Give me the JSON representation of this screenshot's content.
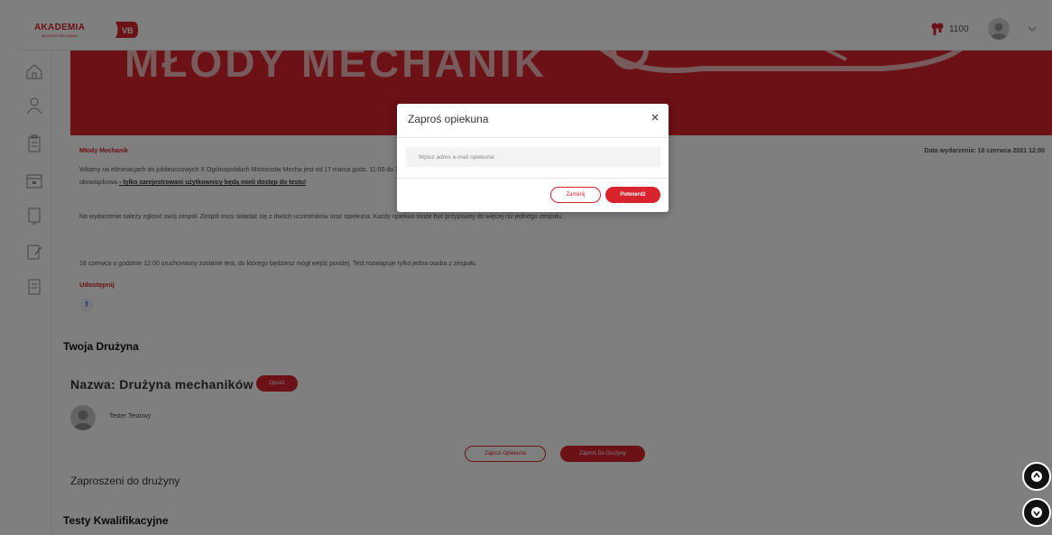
{
  "header": {
    "logo_text": "AKADEMIA",
    "logo_sub": "MŁODEGO MECHANIKA",
    "points": "1100"
  },
  "sidebar": {
    "items": [
      "home-icon",
      "user-icon",
      "clipboard-icon",
      "calendar-icon",
      "tablet-icon",
      "edit-icon",
      "list-icon"
    ]
  },
  "banner": {
    "title": "MŁODY MECHANIK"
  },
  "event": {
    "name": "Młody Mechanik",
    "date": "Data wydarzenia: 18 czerwca 2021 12:00",
    "p1_start": "Witamy na eliminacjach do jubileuszowych X Ogólnopolskich Mistrzostw Mecha",
    "p1_end": " jest od 17 marca godz. 11:00 do 18 czerwca godz. 11:59. Rejestracja na wydarzenie jest",
    "p1_line2": "obowiązkowa ",
    "p1_link": "- tylko zarejestrowani użytkownicy będą mieli dostęp do testu!",
    "p2": "Na wydarzenie należy zgłosić swój zespół. Zespół musi składać się z dwóch uczestników oraz opiekuna. Każdy opiekun może być przypisany do więcej niż jednego zespołu.",
    "p3": "18 czerwca o godzinie 12:00 uruchomiony zostanie test, do którego będziesz mógł wejść poniżej. Test rozwiązuje tylko jedna osoba z zespołu.",
    "share_label": "Udostępnij",
    "fb_label": "f"
  },
  "team": {
    "heading": "Twoja Drużyna",
    "name": "Nazwa: Drużyna mechaników",
    "leave_label": "Opuść",
    "member_name": "Tester Testowy",
    "invite_guardian_label": "Zaproś Opiekuna",
    "invite_team_label": "Zaproś Do Drużyny",
    "invited_heading": "Zaproszeni do drużyny"
  },
  "tests": {
    "heading": "Testy Kwalifikacyjne"
  },
  "modal": {
    "title": "Zaproś opiekuna",
    "email_placeholder": "Wpisz adres e-mail opiekuna",
    "close_label": "Zamknij",
    "confirm_label": "Potwierdź"
  },
  "colors": {
    "brand_red": "#d8232c"
  }
}
